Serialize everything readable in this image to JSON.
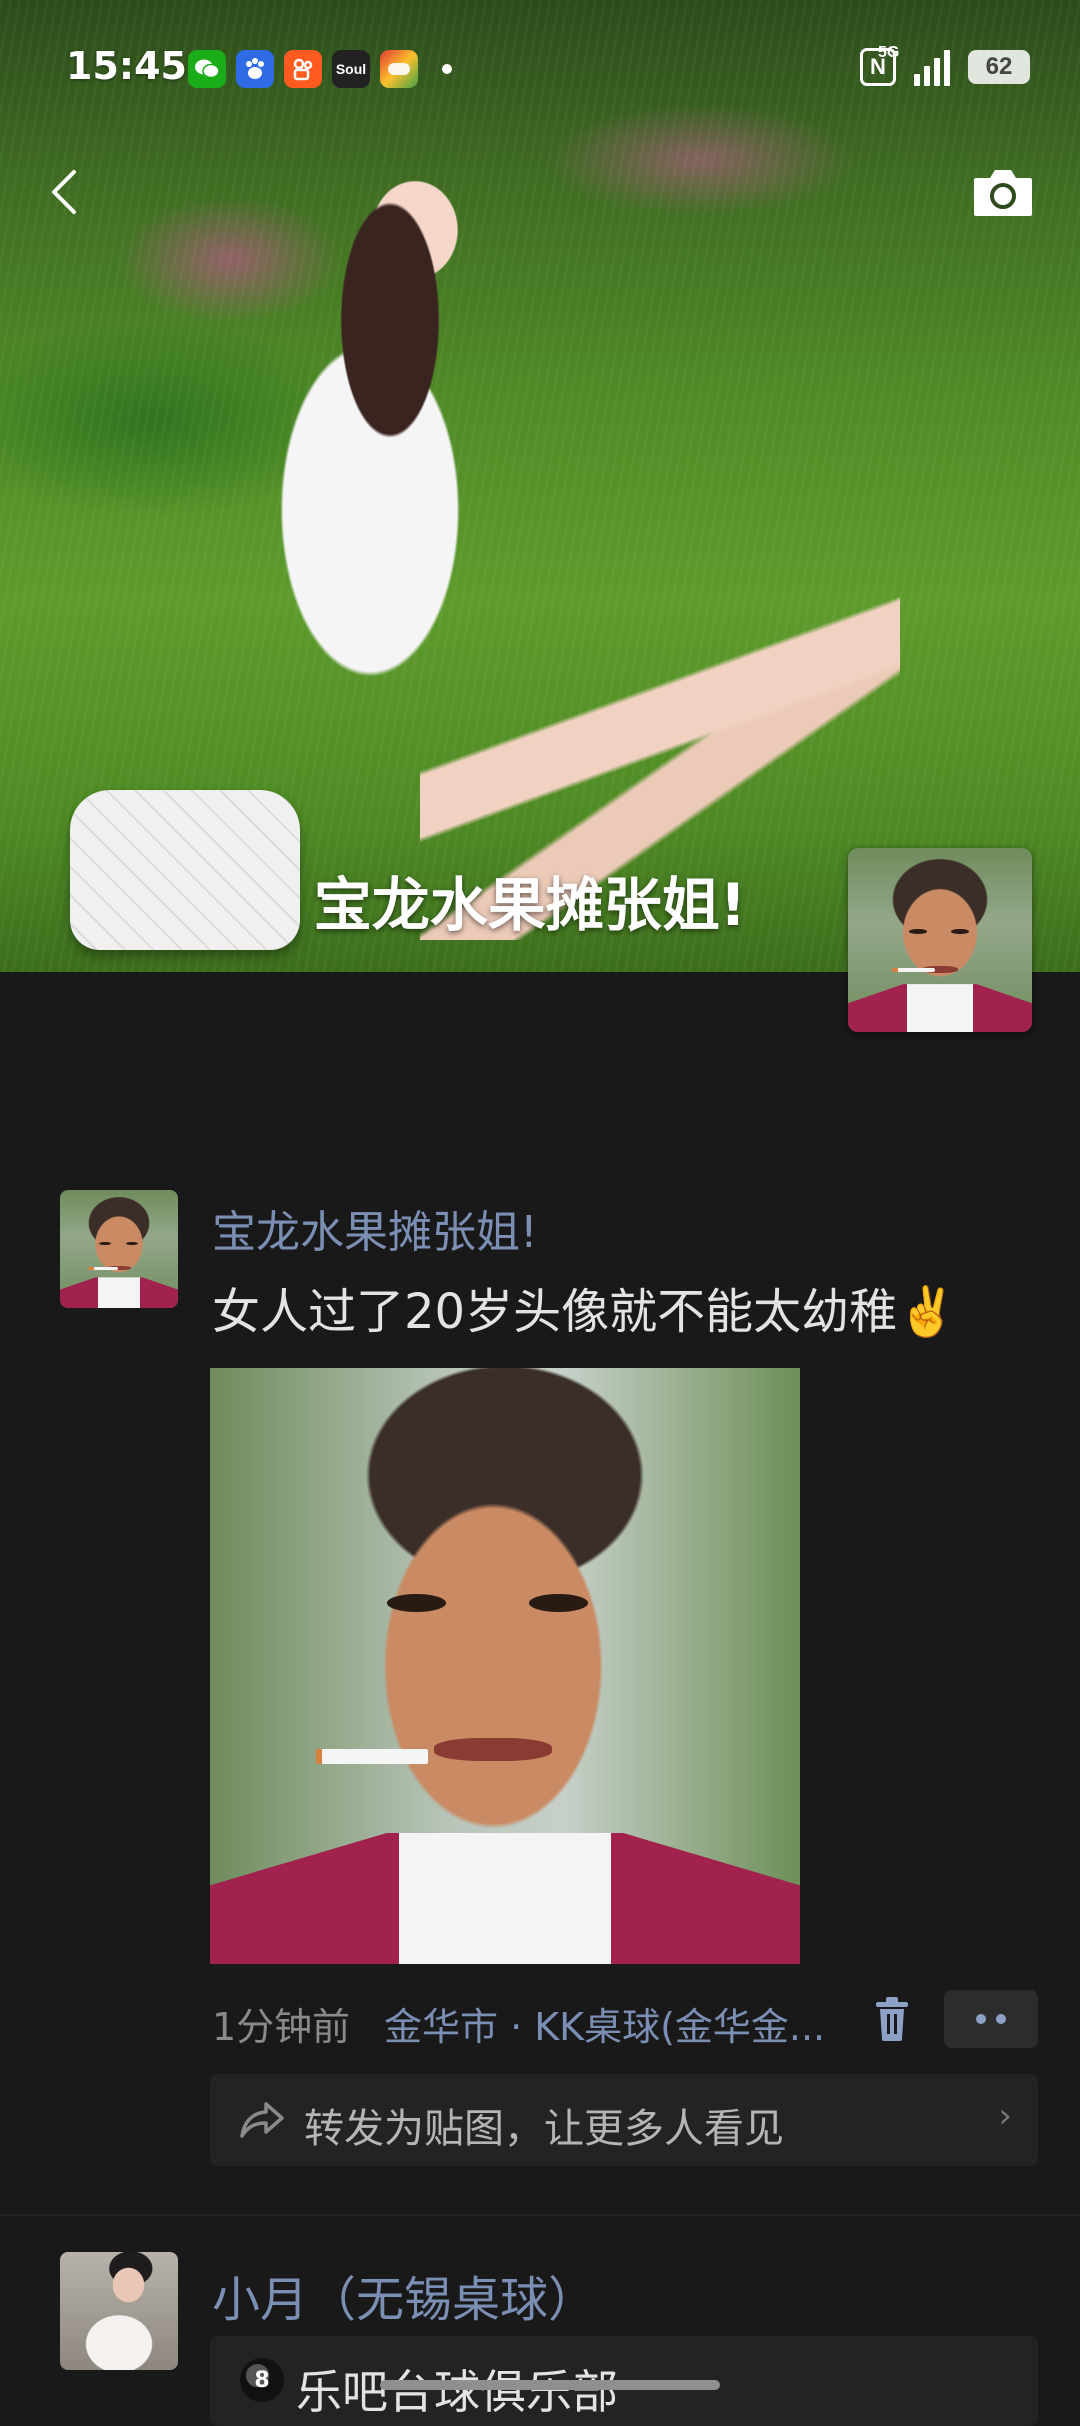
{
  "status_bar": {
    "time": "15:45",
    "notification_icons": [
      "wechat-icon",
      "baidu-icon",
      "kuaishou-icon",
      "soul-icon",
      "game-icon"
    ],
    "soul_label": "Soul",
    "network": "5G",
    "battery": "62"
  },
  "cover": {
    "title": "宝龙水果摊张姐!"
  },
  "post": {
    "author": "宝龙水果摊张姐!",
    "text": "女人过了20岁头像就不能太幼稚✌️",
    "time": "1分钟前",
    "location": "金华市 · KK桌球(金华金...",
    "repost_text": "转发为贴图，让更多人看见",
    "repost_chevron": "›"
  },
  "next_post": {
    "author": "小月（无锡桌球）",
    "card_text": "乐吧台球俱乐部",
    "card_icon": "8"
  },
  "colors": {
    "background": "#191919",
    "link": "#7b8fb5",
    "text": "#e3e3e3",
    "muted": "#8a8a8a"
  }
}
